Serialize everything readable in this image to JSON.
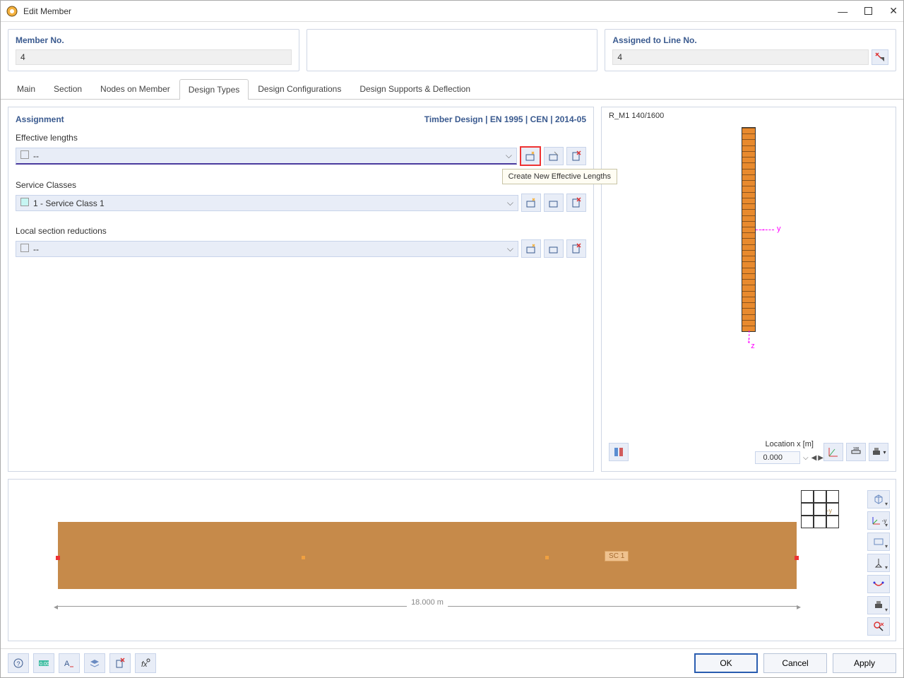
{
  "window": {
    "title": "Edit Member"
  },
  "top": {
    "member_no_label": "Member No.",
    "member_no_value": "4",
    "assigned_label": "Assigned to Line No.",
    "assigned_value": "4"
  },
  "tabs": [
    "Main",
    "Section",
    "Nodes on Member",
    "Design Types",
    "Design Configurations",
    "Design Supports & Deflection"
  ],
  "active_tab": "Design Types",
  "assignment": {
    "header": "Assignment",
    "standard": "Timber Design | EN 1995 | CEN | 2014-05",
    "effective_lengths": {
      "label": "Effective lengths",
      "value": "--",
      "tooltip": "Create New Effective Lengths"
    },
    "service_classes": {
      "label": "Service Classes",
      "value": "1 - Service Class 1"
    },
    "local_reductions": {
      "label": "Local section reductions",
      "value": "--"
    }
  },
  "section": {
    "name": "R_M1 140/1600",
    "axis_y": "y",
    "axis_z": "z",
    "location_label": "Location x [m]",
    "location_value": "0.000"
  },
  "beam": {
    "sc_badge": "SC 1",
    "length": "18.000 m",
    "nav_y": "-y"
  },
  "footer": {
    "ok": "OK",
    "cancel": "Cancel",
    "apply": "Apply"
  }
}
